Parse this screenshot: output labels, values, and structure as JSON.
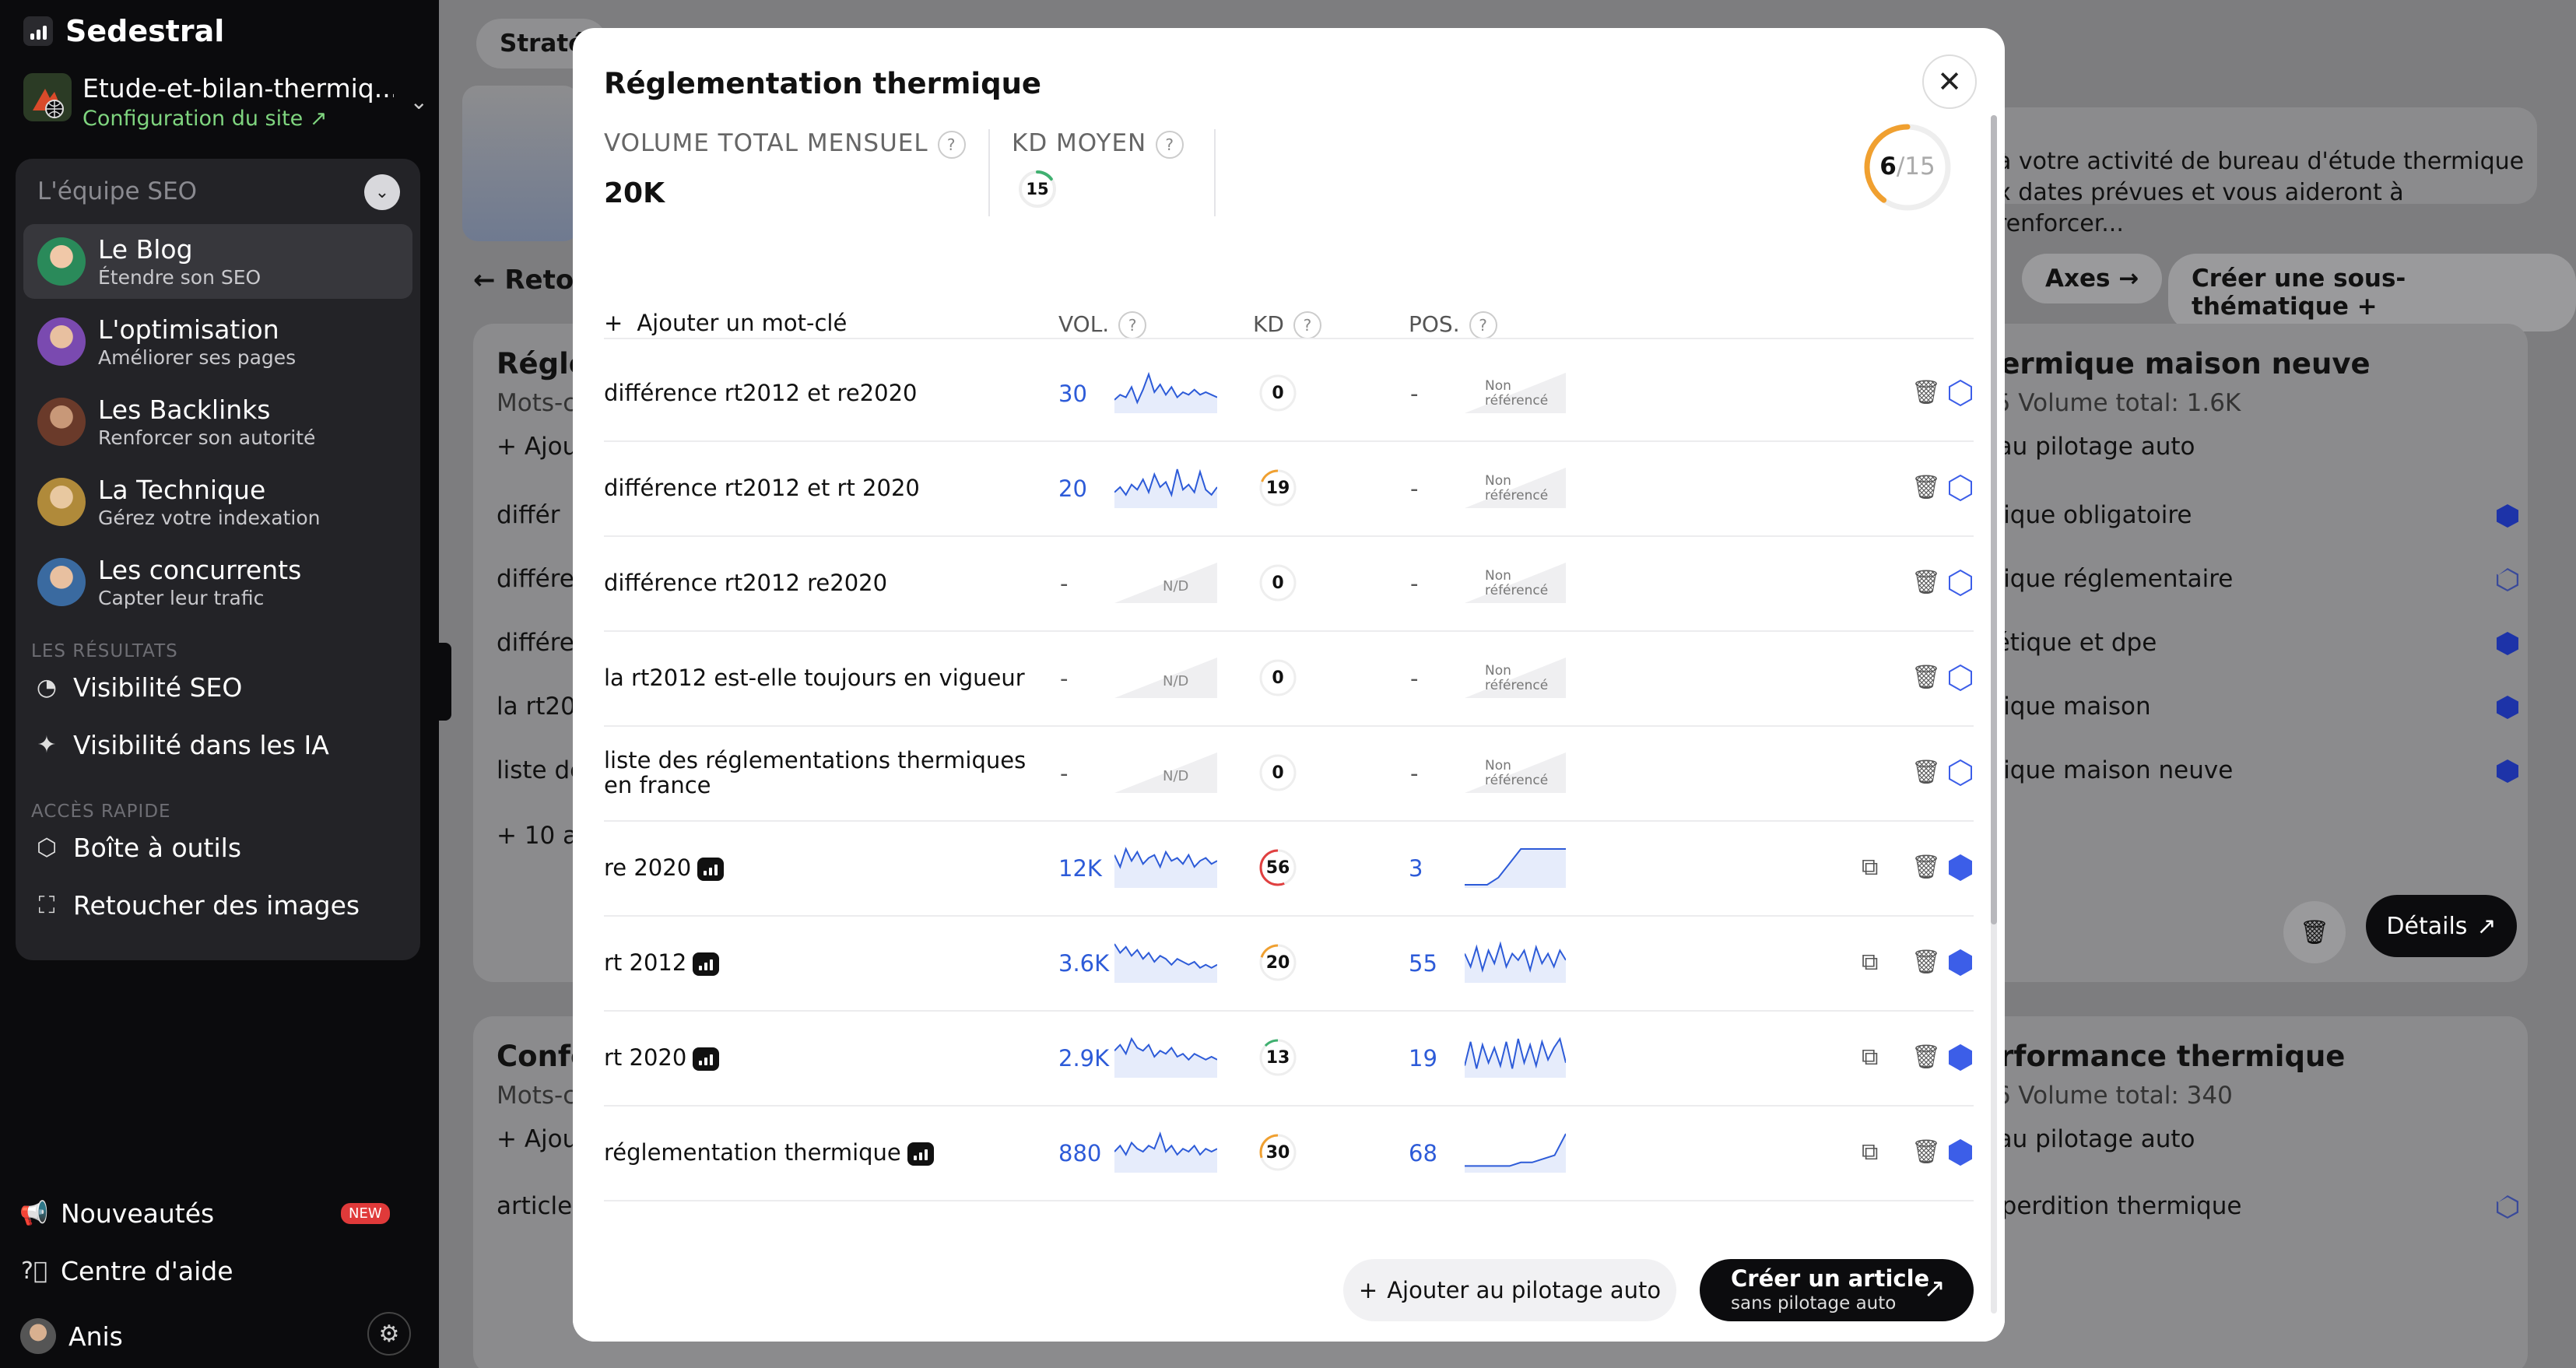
{
  "app": {
    "name": "Sedestral"
  },
  "site": {
    "name": "Etude-et-bilan-thermiq...",
    "config_label": "Configuration du site"
  },
  "team": {
    "header": "L'équipe SEO",
    "agents": [
      {
        "title": "Le Blog",
        "subtitle": "Étendre son SEO"
      },
      {
        "title": "L'optimisation",
        "subtitle": "Améliorer ses pages"
      },
      {
        "title": "Les Backlinks",
        "subtitle": "Renforcer son autorité"
      },
      {
        "title": "La Technique",
        "subtitle": "Gérez votre indexation"
      },
      {
        "title": "Les concurrents",
        "subtitle": "Capter leur trafic"
      }
    ]
  },
  "results": {
    "header": "LES RÉSULTATS",
    "items": [
      "Visibilité SEO",
      "Visibilité dans les IA"
    ]
  },
  "quick": {
    "header": "ACCÈS RAPIDE",
    "items": [
      "Boîte à outils",
      "Retoucher des images"
    ]
  },
  "bottom": {
    "news": "Nouveautés",
    "new_badge": "NEW",
    "help": "Centre d'aide",
    "user": "Anis"
  },
  "background": {
    "tab": "Straté",
    "back": "Reto",
    "banner": "à votre activité de bureau d'étude thermique x dates prévues et vous aideront à renforcer...",
    "axes": "Axes",
    "create_sub": "Créer une sous-thématique",
    "card1": {
      "title": "Régle",
      "title_right": "hermique maison neuve",
      "kw_label": "Mots-cl",
      "stats": "15   Volume total: 1.6K",
      "autopilot": "r au pilotage auto",
      "add": "Ajou",
      "left": [
        "différ",
        "différe",
        "différe",
        "la rt2012",
        "liste des"
      ],
      "right": [
        "mique obligatoire",
        "mique réglementaire",
        "gétique et dpe",
        "mique maison",
        "mique maison neuve"
      ],
      "more": "+ 10 aut",
      "details": "Détails"
    },
    "card2": {
      "title": "Confo",
      "title_right": "erformance thermique",
      "kw_label": "Mots-cl",
      "stats": "16   Volume total: 340",
      "autopilot": "r au pilotage auto",
      "add": "Ajou",
      "left": [
        "article 2"
      ],
      "right": [
        "léperdition thermique"
      ]
    }
  },
  "modal": {
    "title": "Réglementation thermique",
    "volume_label": "VOLUME TOTAL MENSUEL",
    "volume_value": "20K",
    "kd_label": "KD MOYEN",
    "kd_value": "15",
    "kd_fraction": 0.15,
    "score_value": "6",
    "score_total": "/15",
    "score_fraction": 0.4,
    "add_keyword": "Ajouter un mot-clé",
    "col_vol": "VOL.",
    "col_kd": "KD",
    "col_pos": "POS.",
    "nd_label": "N/D",
    "nr_label": "Non référencé",
    "rows": [
      {
        "kw": "différence rt2012 et re2020",
        "vol": "30",
        "kd": "0",
        "kd_color": "#cccccc",
        "pos": "-",
        "spark": [
          4,
          6,
          5,
          9,
          3,
          8,
          14,
          7,
          10,
          6,
          9,
          5,
          7,
          6,
          8,
          6,
          7,
          6,
          5
        ],
        "pos_spark": null,
        "ranked": false
      },
      {
        "kw": "différence rt2012 et rt 2020",
        "vol": "20",
        "kd": "19",
        "kd_color": "#f0a030",
        "pos": "-",
        "spark": [
          5,
          7,
          4,
          8,
          6,
          10,
          5,
          12,
          7,
          9,
          4,
          14,
          6,
          8,
          5,
          13,
          6,
          4,
          7
        ],
        "pos_spark": null,
        "ranked": false
      },
      {
        "kw": "différence rt2012 re2020",
        "vol": "-",
        "kd": "0",
        "kd_color": "#cccccc",
        "pos": "-",
        "spark": null,
        "pos_spark": null,
        "ranked": false
      },
      {
        "kw": "la rt2012 est-elle toujours en vigueur",
        "vol": "-",
        "kd": "0",
        "kd_color": "#cccccc",
        "pos": "-",
        "spark": null,
        "pos_spark": null,
        "ranked": false
      },
      {
        "kw": "liste des réglementations thermiques en france",
        "vol": "-",
        "kd": "0",
        "kd_color": "#cccccc",
        "pos": "-",
        "spark": null,
        "pos_spark": null,
        "ranked": false
      },
      {
        "kw": "re 2020",
        "vol": "12K",
        "kd": "56",
        "kd_color": "#e04040",
        "pos": "3",
        "spark": [
          10,
          6,
          12,
          8,
          11,
          7,
          9,
          10,
          6,
          11,
          8,
          9,
          7,
          10,
          6,
          8,
          9,
          7,
          8
        ],
        "pos_spark": [
          0,
          0,
          0,
          2,
          6,
          10,
          10,
          10,
          10,
          10
        ],
        "ranked": true
      },
      {
        "kw": "rt 2012",
        "vol": "3.6K",
        "kd": "20",
        "kd_color": "#f0a030",
        "pos": "55",
        "spark": [
          12,
          9,
          11,
          8,
          10,
          7,
          9,
          6,
          8,
          7,
          5,
          7,
          6,
          5,
          6,
          4,
          5,
          4,
          5
        ],
        "pos_spark": [
          8,
          4,
          10,
          3,
          9,
          5,
          11,
          4,
          8,
          6,
          9,
          3,
          10,
          5,
          8,
          4,
          9,
          6
        ],
        "ranked": true
      },
      {
        "kw": "rt 2020",
        "vol": "2.9K",
        "kd": "13",
        "kd_color": "#40b070",
        "pos": "19",
        "spark": [
          8,
          10,
          7,
          12,
          9,
          8,
          10,
          6,
          8,
          7,
          9,
          6,
          7,
          5,
          7,
          6,
          5,
          6,
          5
        ],
        "pos_spark": [
          3,
          11,
          2,
          10,
          4,
          9,
          3,
          11,
          2,
          12,
          4,
          10,
          3,
          11,
          5,
          9,
          12,
          4
        ],
        "ranked": true
      },
      {
        "kw": "réglementation thermique",
        "vol": "880",
        "kd": "30",
        "kd_color": "#f0a030",
        "pos": "68",
        "spark": [
          6,
          8,
          5,
          9,
          7,
          6,
          8,
          7,
          12,
          6,
          8,
          5,
          7,
          6,
          8,
          5,
          7,
          6,
          7
        ],
        "pos_spark": [
          1,
          1,
          1,
          1,
          1,
          2,
          2,
          3,
          4,
          10
        ],
        "ranked": true
      }
    ],
    "autopilot_button": "Ajouter au pilotage auto",
    "create_article": "Créer un article",
    "create_article_sub": "sans pilotage auto"
  },
  "colors": {
    "accent": "#2d5bd8",
    "hex_filled": "#3c5ee8",
    "dark": "#0c0c0e"
  }
}
